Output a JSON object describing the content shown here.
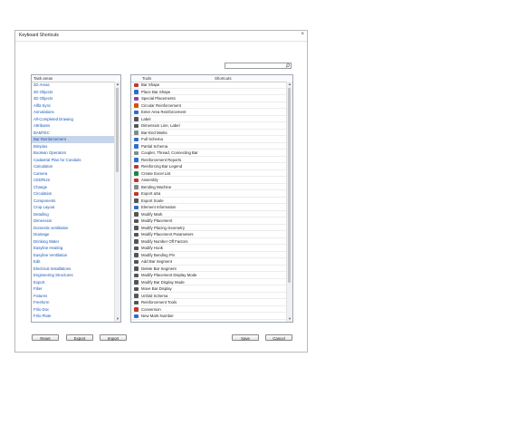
{
  "dialog": {
    "title": "Keyboard Shortcuts",
    "close_glyph": "×"
  },
  "search": {
    "placeholder": "",
    "value": "",
    "icon": "search-icon"
  },
  "task_areas": {
    "header": "Task areas",
    "selected": "Bar Reinforcement",
    "items": [
      "2D Areas",
      "2D Objects",
      "3D Objects",
      "Allfa Sync",
      "Annotations",
      "All-Completed Drawing",
      "Attributes",
      "BAMTEC",
      "Bar Reinforcement",
      "Bimplus",
      "Boolean Operators",
      "Cadastral Plan for Conduits",
      "Calculation",
      "Camera",
      "CEDRUS",
      "Change",
      "Circulation",
      "Components",
      "Crop Layout",
      "Detailing",
      "Dimension",
      "Domestic ventilation",
      "Drainage",
      "Drinking Water",
      "Easyline Heating",
      "Easyline Ventilation",
      "Edit",
      "Electrical Installations",
      "Engineering Structures",
      "Export",
      "Filter",
      "Fixtures",
      "Freeform",
      "Frilo Doc",
      "Frilo Plate"
    ]
  },
  "tools": {
    "col_tools": "Tools",
    "col_shortcuts": "Shortcuts",
    "items": [
      {
        "label": "Bar Shape",
        "shortcut": "",
        "icon": "bar-shape-icon",
        "color": "#c0392b"
      },
      {
        "label": "Place Bar Shape",
        "shortcut": "",
        "icon": "place-bar-shape-icon",
        "color": "#2c6ec9"
      },
      {
        "label": "Special Placements",
        "shortcut": "",
        "icon": "special-placements-icon",
        "color": "#8e44ad"
      },
      {
        "label": "Circular Reinforcement",
        "shortcut": "",
        "icon": "circular-reinforcement-icon",
        "color": "#d35400"
      },
      {
        "label": "Enter Area Reinforcement",
        "shortcut": "",
        "icon": "area-reinforcement-icon",
        "color": "#2c6ec9"
      },
      {
        "label": "Label",
        "shortcut": "",
        "icon": "label-icon",
        "color": "#555555"
      },
      {
        "label": "Dimension Line, Label",
        "shortcut": "",
        "icon": "dimension-line-icon",
        "color": "#555555"
      },
      {
        "label": "Bar-End Marks",
        "shortcut": "",
        "icon": "bar-end-marks-icon",
        "color": "#7f8c8d"
      },
      {
        "label": "Full Schema",
        "shortcut": "",
        "icon": "full-schema-icon",
        "color": "#2c6ec9"
      },
      {
        "label": "Partial Schema",
        "shortcut": "",
        "icon": "partial-schema-icon",
        "color": "#2c6ec9"
      },
      {
        "label": "Coupler, Thread, Connecting Bar",
        "shortcut": "",
        "icon": "coupler-icon",
        "color": "#7f8c8d"
      },
      {
        "label": "Reinforcement Reports",
        "shortcut": "",
        "icon": "reports-icon",
        "color": "#2c6ec9"
      },
      {
        "label": "Reinforcing Bar Legend",
        "shortcut": "",
        "icon": "legend-icon",
        "color": "#c0392b"
      },
      {
        "label": "Create Excel List",
        "shortcut": "",
        "icon": "excel-icon",
        "color": "#1e8449"
      },
      {
        "label": "Assembly",
        "shortcut": "",
        "icon": "assembly-icon",
        "color": "#c0392b"
      },
      {
        "label": "Bending Machine",
        "shortcut": "",
        "icon": "bending-machine-icon",
        "color": "#7f8c8d"
      },
      {
        "label": "Export aSa",
        "shortcut": "",
        "icon": "export-asa-icon",
        "color": "#c0392b"
      },
      {
        "label": "Export Soule",
        "shortcut": "",
        "icon": "export-soule-icon",
        "color": "#555555"
      },
      {
        "label": "Element Information",
        "shortcut": "",
        "icon": "element-info-icon",
        "color": "#2c6ec9"
      },
      {
        "label": "Modify Mark",
        "shortcut": "",
        "icon": "modify-mark-icon",
        "color": "#555555"
      },
      {
        "label": "Modify Placement",
        "shortcut": "",
        "icon": "modify-placement-icon",
        "color": "#555555"
      },
      {
        "label": "Modify Placing Geometry",
        "shortcut": "",
        "icon": "modify-geometry-icon",
        "color": "#555555"
      },
      {
        "label": "Modify Placement Parameters",
        "shortcut": "",
        "icon": "modify-parameters-icon",
        "color": "#555555"
      },
      {
        "label": "Modify Number Off Factors",
        "shortcut": "",
        "icon": "modify-factors-icon",
        "color": "#555555"
      },
      {
        "label": "Modify Hook",
        "shortcut": "",
        "icon": "modify-hook-icon",
        "color": "#555555"
      },
      {
        "label": "Modify Bending Pin",
        "shortcut": "",
        "icon": "bending-pin-icon",
        "color": "#555555"
      },
      {
        "label": "Add Bar Segment",
        "shortcut": "",
        "icon": "add-segment-icon",
        "color": "#555555"
      },
      {
        "label": "Delete Bar Segment",
        "shortcut": "",
        "icon": "delete-segment-icon",
        "color": "#555555"
      },
      {
        "label": "Modify Placement Display Mode",
        "shortcut": "",
        "icon": "display-mode-icon",
        "color": "#555555"
      },
      {
        "label": "Modify Bar Display Mode",
        "shortcut": "",
        "icon": "bar-display-mode-icon",
        "color": "#555555"
      },
      {
        "label": "Move Bar Display",
        "shortcut": "",
        "icon": "move-display-icon",
        "color": "#555555"
      },
      {
        "label": "Unfold Schema",
        "shortcut": "",
        "icon": "unfold-schema-icon",
        "color": "#555555"
      },
      {
        "label": "Reinforcement Tools",
        "shortcut": "",
        "icon": "tools-icon",
        "color": "#555555"
      },
      {
        "label": "Conversion",
        "shortcut": "",
        "icon": "conversion-icon",
        "color": "#c0392b"
      },
      {
        "label": "New Mark Number",
        "shortcut": "",
        "icon": "new-mark-icon",
        "color": "#2c6ec9"
      }
    ]
  },
  "buttons": {
    "reset": "Reset",
    "export": "Export",
    "import": "Import",
    "save": "Save",
    "cancel": "Cancel"
  },
  "colors": {
    "link_text": "#1a56b8",
    "selection": "#c7d5ea",
    "panel_border": "#9fa8b6"
  }
}
